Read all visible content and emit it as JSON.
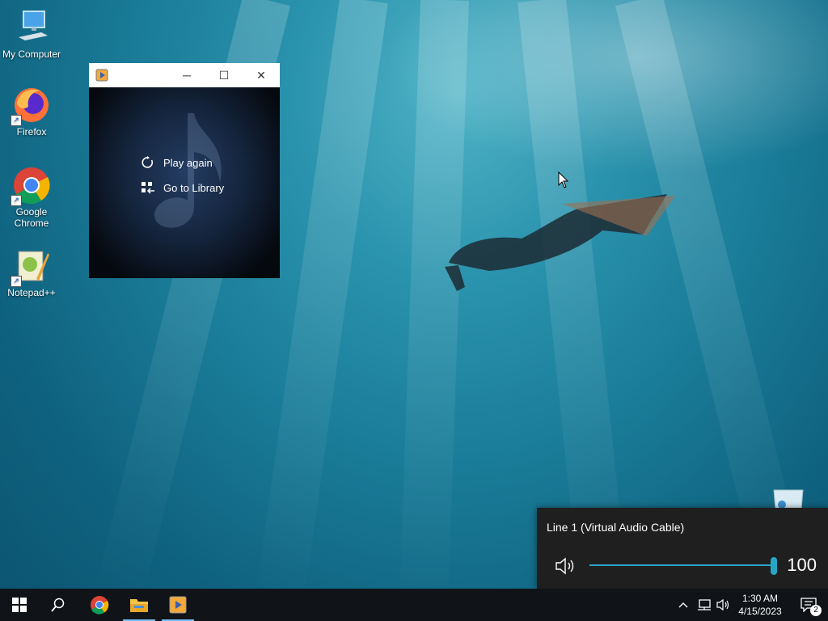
{
  "desktop": {
    "icons": [
      {
        "label": "My Computer"
      },
      {
        "label": "Firefox"
      },
      {
        "label": "Google Chrome"
      },
      {
        "label": "Notepad++"
      }
    ]
  },
  "player_window": {
    "minimize_glyph": "─",
    "maximize_glyph": "☐",
    "close_glyph": "✕",
    "menu": [
      {
        "label": "Play again",
        "icon": "replay-icon"
      },
      {
        "label": "Go to Library",
        "icon": "library-icon"
      }
    ]
  },
  "volume_flyout": {
    "device": "Line 1 (Virtual Audio Cable)",
    "level": 100,
    "level_text": "100",
    "accent": "#26a6c7"
  },
  "taskbar": {
    "clock_time": "1:30 AM",
    "clock_date": "4/15/2023",
    "notification_count": "2",
    "accent": "#76b9ed"
  }
}
